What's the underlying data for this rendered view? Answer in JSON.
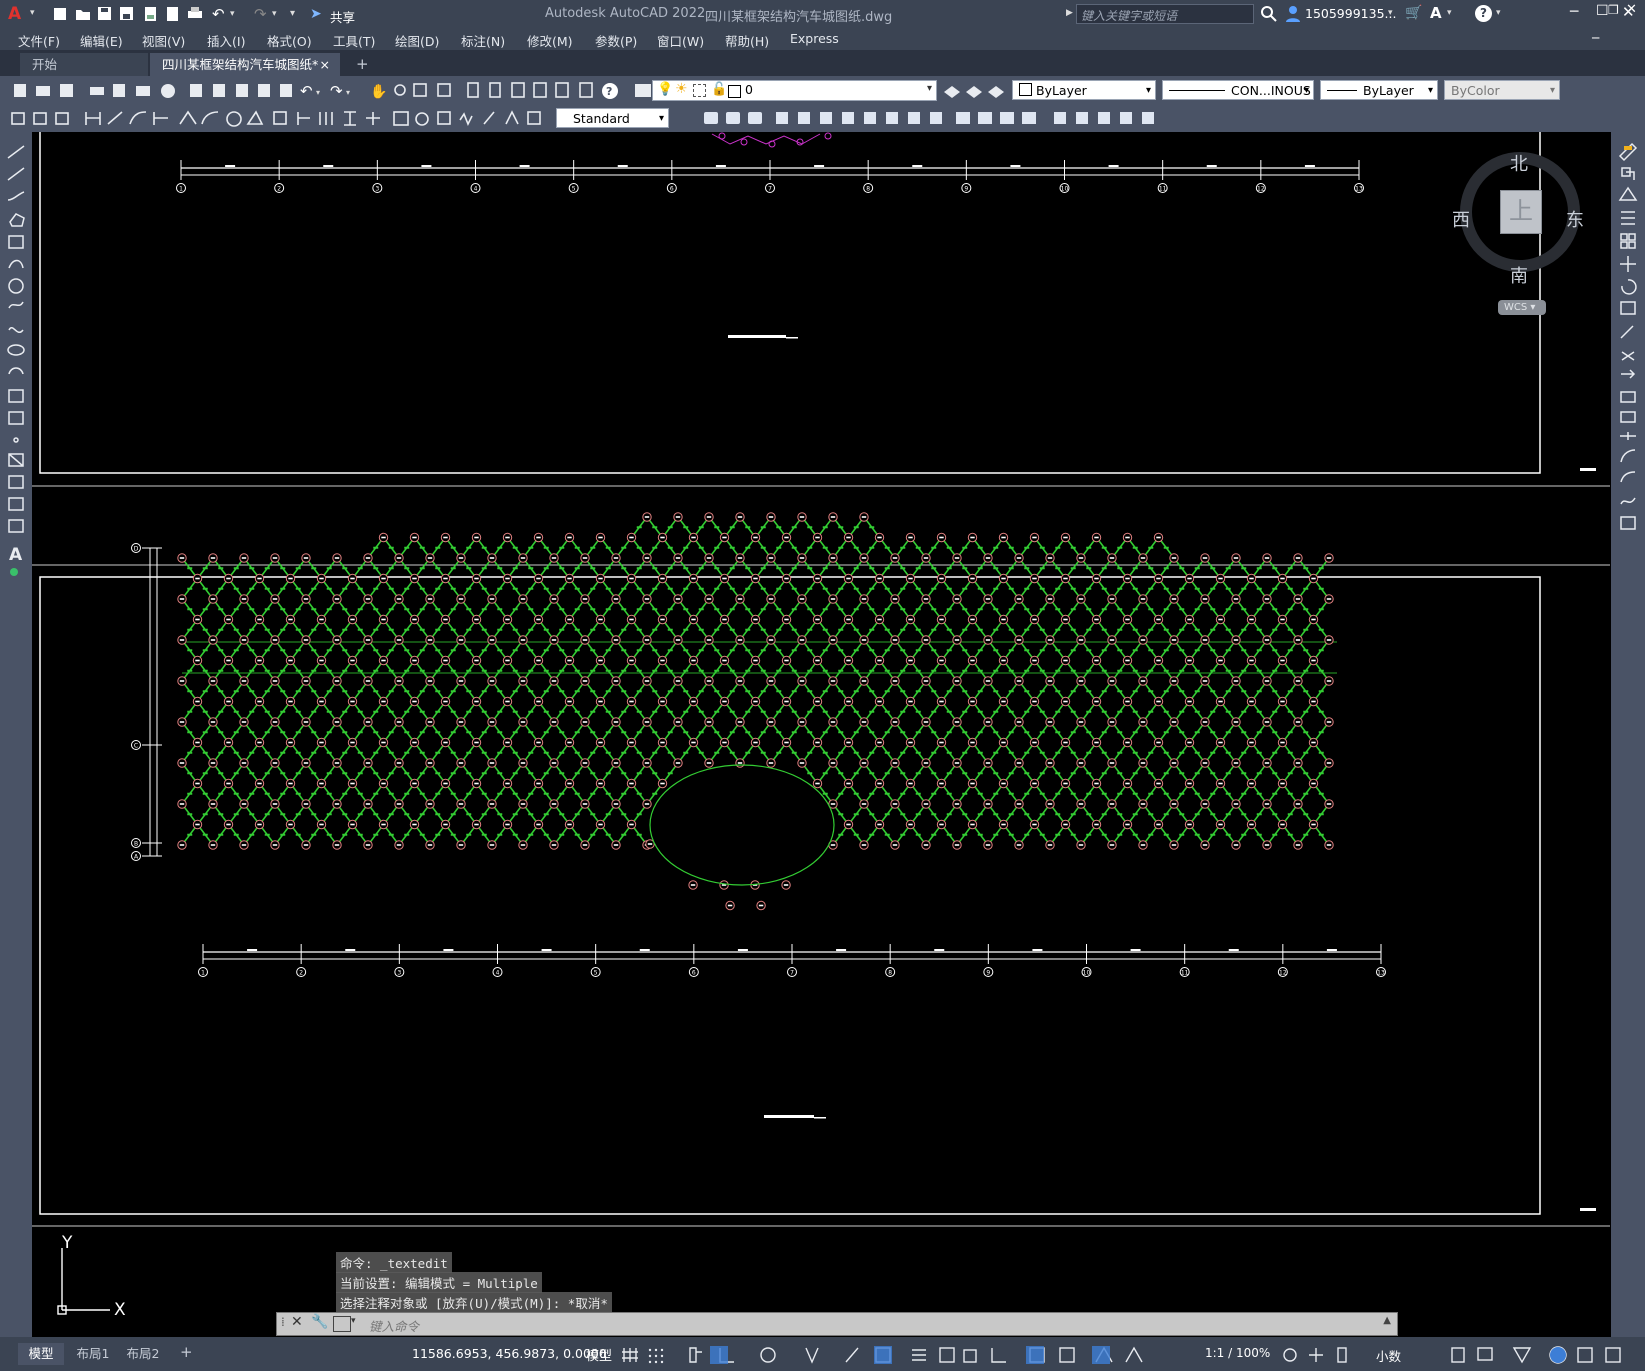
{
  "app": {
    "title": "Autodesk AutoCAD 2022",
    "file": "四川某框架结构汽车城图纸.dwg",
    "share": "共享",
    "search_placeholder": "键入关键字或短语",
    "user": "1505999135...",
    "logo": "A"
  },
  "menu": [
    "文件(F)",
    "编辑(E)",
    "视图(V)",
    "插入(I)",
    "格式(O)",
    "工具(T)",
    "绘图(D)",
    "标注(N)",
    "修改(M)",
    "参数(P)",
    "窗口(W)",
    "帮助(H)",
    "Express"
  ],
  "tabs": {
    "start": "开始",
    "active": "四川某框架结构汽车城图纸*",
    "close": "×",
    "add": "+"
  },
  "toolbar": {
    "layer": "0",
    "color": "ByLayer",
    "linetype": "CON...INOUS",
    "lineweight": "ByLayer",
    "plotstyle": "ByColor",
    "textstyle": "Standard"
  },
  "viewcube": {
    "north": "北",
    "south": "南",
    "east": "东",
    "west": "西",
    "face": "上",
    "wcs": "WCS"
  },
  "ucs": {
    "x": "X",
    "y": "Y"
  },
  "command": {
    "history": [
      "命令: _textedit",
      "当前设置: 编辑模式 = Multiple",
      "选择注释对象或 [放弃(U)/模式(M)]: *取消*"
    ],
    "placeholder": "键入命令"
  },
  "status": {
    "layouts": [
      "模型",
      "布局1",
      "布局2"
    ],
    "add_layout": "+",
    "coords": "11586.6953, 456.9873, 0.0000",
    "model": "模型",
    "scale": "1:1 / 100%",
    "units": "小数"
  },
  "drawing": {
    "axis_labels_top": [
      "1",
      "2",
      "3",
      "4",
      "5",
      "6",
      "7",
      "8",
      "9",
      "10",
      "11",
      "12",
      "13"
    ],
    "axis_labels_bottom": [
      "1",
      "2",
      "3",
      "4",
      "5",
      "6",
      "7",
      "8",
      "9",
      "10",
      "11",
      "12",
      "13"
    ],
    "left_axis_labels": [
      "D",
      "C",
      "B",
      "A"
    ],
    "colors": {
      "frame": "#ffffff",
      "member": "#33cc33",
      "node": "#e08080",
      "accent": "#cc33cc"
    }
  }
}
